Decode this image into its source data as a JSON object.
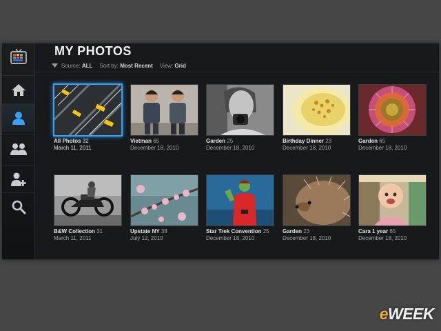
{
  "header": {
    "title": "MY PHOTOS"
  },
  "filters": {
    "source_label": "Source:",
    "source_value": "ALL",
    "sort_label": "Sort by:",
    "sort_value": "Most Recent",
    "view_label": "View:",
    "view_value": "Grid"
  },
  "sidebar": {
    "items": [
      {
        "name": "tv-icon"
      },
      {
        "name": "home-icon"
      },
      {
        "name": "user-icon",
        "active": true
      },
      {
        "name": "users-icon"
      },
      {
        "name": "add-user-icon"
      },
      {
        "name": "search-icon"
      }
    ]
  },
  "albums": [
    {
      "title": "All Photos",
      "count": "32",
      "date": "March 11, 2011",
      "selected": true
    },
    {
      "title": "Vietman",
      "count": "65",
      "date": "December 18, 2010"
    },
    {
      "title": "Garden",
      "count": "25",
      "date": "December 18, 2010"
    },
    {
      "title": "Birthday Dinner",
      "count": "23",
      "date": "December 18, 2010"
    },
    {
      "title": "Garden",
      "count": "65",
      "date": "December 18, 2010"
    },
    {
      "title": "B&W Collection",
      "count": "31",
      "date": "March 11, 2011"
    },
    {
      "title": "Upstate NY",
      "count": "38",
      "date": "July 12, 2010"
    },
    {
      "title": "Star Trek Convention",
      "count": "25",
      "date": "December 18, 2010"
    },
    {
      "title": "Garden",
      "count": "23",
      "date": "December 18, 2010"
    },
    {
      "title": "Cara 1 year",
      "count": "65",
      "date": "December 18, 2010"
    }
  ],
  "watermark": {
    "prefix": "e",
    "rest": "WEEK"
  },
  "colors": {
    "accent": "#3aa0f0",
    "watermark_e": "#f0b030"
  }
}
